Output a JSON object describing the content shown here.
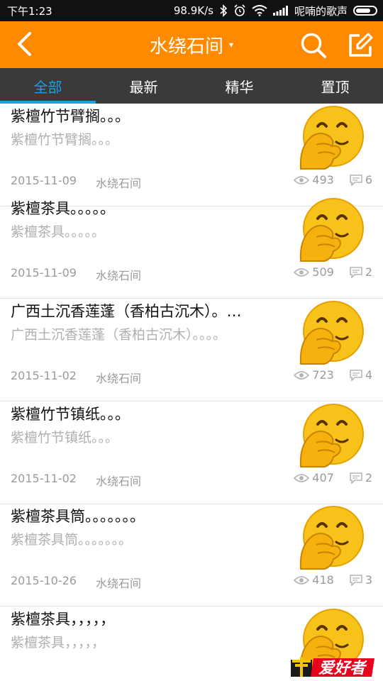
{
  "status_bar": {
    "time": "下午1:23",
    "network_speed": "98.9K/s",
    "carrier": "呢喃的歌声"
  },
  "app_bar": {
    "title": "水绕石间",
    "caret": "▾"
  },
  "tabs": [
    {
      "label": "全部",
      "active": true
    },
    {
      "label": "最新",
      "active": false
    },
    {
      "label": "精华",
      "active": false
    },
    {
      "label": "置顶",
      "active": false
    }
  ],
  "posts": [
    {
      "title": "紫檀竹节臂搁。。。",
      "snippet": "紫檀竹节臂搁。。。",
      "date": "2015-11-09",
      "board": "水绕石间",
      "views": "493",
      "comments": "6"
    },
    {
      "title": "紫檀茶具。。。。。",
      "snippet": "紫檀茶具。。。。。",
      "date": "2015-11-09",
      "board": "水绕石间",
      "views": "509",
      "comments": "2"
    },
    {
      "title": "广西土沉香莲蓬（香柏古沉木）。…",
      "snippet": "广西土沉香莲蓬（香柏古沉木）。。。。",
      "date": "2015-11-02",
      "board": "水绕石间",
      "views": "723",
      "comments": "4"
    },
    {
      "title": "紫檀竹节镇纸。。。",
      "snippet": "紫檀竹节镇纸。。。",
      "date": "2015-11-02",
      "board": "水绕石间",
      "views": "407",
      "comments": "2"
    },
    {
      "title": "紫檀茶具筒。。。。。。。",
      "snippet": "紫檀茶具筒。。。。。。。",
      "date": "2015-10-26",
      "board": "水绕石间",
      "views": "418",
      "comments": "3"
    },
    {
      "title": "紫檀茶具，，，，，",
      "snippet": "紫檀茶具，，，，，",
      "date": "",
      "board": "",
      "views": "",
      "comments": ""
    }
  ],
  "watermark": {
    "text": "爱好者"
  },
  "colors": {
    "accent": "#ff8a00",
    "tab_active": "#1ba1e2",
    "tab_bar": "#3a3a3a"
  }
}
